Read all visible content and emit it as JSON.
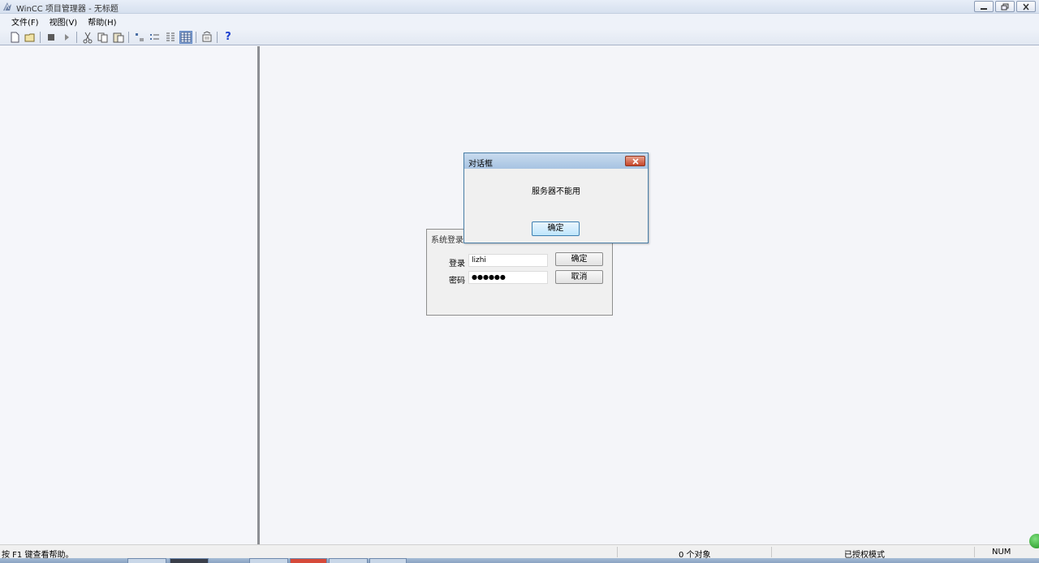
{
  "window": {
    "title": "WinCC 项目管理器 - 无标题"
  },
  "menu": {
    "items": [
      {
        "label": "文件(F)"
      },
      {
        "label": "视图(V)"
      },
      {
        "label": "帮助(H)"
      }
    ]
  },
  "toolbar": {
    "icons": [
      "new-icon",
      "open-icon",
      "stop-icon",
      "run-icon",
      "cut-icon",
      "copy-icon",
      "paste-icon",
      "large-icons-icon",
      "small-icons-icon",
      "list-icon",
      "details-icon",
      "properties-icon",
      "help-icon"
    ],
    "active": "details-icon",
    "help_glyph": "?"
  },
  "login_dialog": {
    "title": "系统登录",
    "login_label": "登录",
    "login_value": "lizhi",
    "password_label": "密码",
    "password_value": "●●●●●●",
    "ok_label": "确定",
    "cancel_label": "取消"
  },
  "message_dialog": {
    "title": "对话框",
    "message": "服务器不能用",
    "ok_label": "确定"
  },
  "statusbar": {
    "help_text": "按 F1 键查看帮助。",
    "object_count": "0 个对象",
    "license_mode": "已授权模式",
    "num_indicator": "NUM"
  },
  "colors": {
    "accent_active": "#5f88c7",
    "dialog_border": "#4a7fa8",
    "close_button": "#c7472a"
  }
}
